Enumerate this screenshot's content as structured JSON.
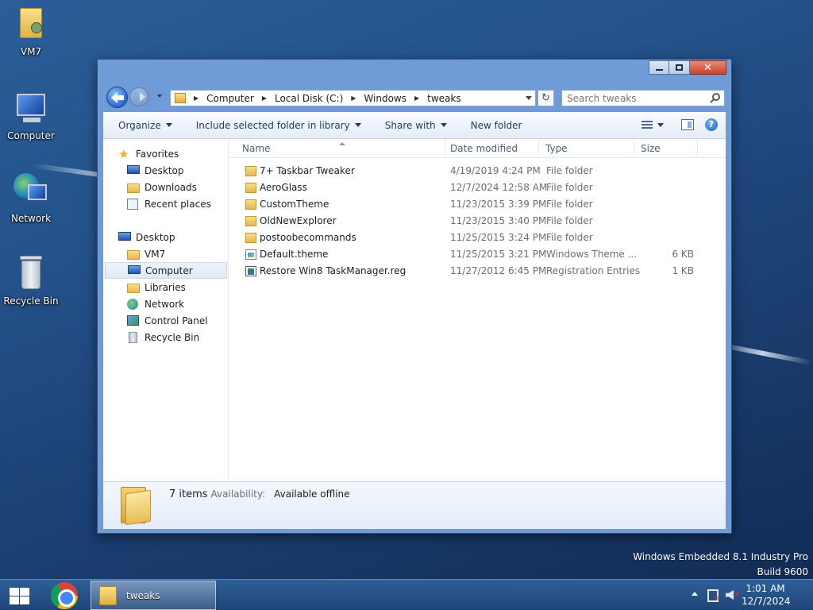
{
  "desktop": {
    "icons": [
      {
        "label": "VM7"
      },
      {
        "label": "Computer"
      },
      {
        "label": "Network"
      },
      {
        "label": "Recycle Bin"
      }
    ],
    "watermark": {
      "line1": "Windows Embedded 8.1 Industry Pro",
      "line2": "Build 9600"
    }
  },
  "window": {
    "address": {
      "crumbs": [
        "Computer",
        "Local Disk (C:)",
        "Windows",
        "tweaks"
      ]
    },
    "search": {
      "placeholder": "Search tweaks"
    },
    "toolbar": {
      "organize": "Organize",
      "include": "Include selected folder in library",
      "share": "Share with",
      "new_folder": "New folder"
    },
    "navpane": {
      "favorites": "Favorites",
      "fav_items": [
        "Desktop",
        "Downloads",
        "Recent places"
      ],
      "desktop": "Desktop",
      "desktop_items": [
        "VM7",
        "Computer",
        "Libraries",
        "Network",
        "Control Panel",
        "Recycle Bin"
      ],
      "selected": "Computer"
    },
    "columns": {
      "name": "Name",
      "date": "Date modified",
      "type": "Type",
      "size": "Size"
    },
    "files": [
      {
        "name": "7+ Taskbar Tweaker",
        "date": "4/19/2019 4:24 PM",
        "type": "File folder",
        "size": "",
        "icon": "folder-icon"
      },
      {
        "name": "AeroGlass",
        "date": "12/7/2024 12:58 AM",
        "type": "File folder",
        "size": "",
        "icon": "folder-icon"
      },
      {
        "name": "CustomTheme",
        "date": "11/23/2015 3:39 PM",
        "type": "File folder",
        "size": "",
        "icon": "folder-icon"
      },
      {
        "name": "OldNewExplorer",
        "date": "11/23/2015 3:40 PM",
        "type": "File folder",
        "size": "",
        "icon": "folder-icon"
      },
      {
        "name": "postoobecommands",
        "date": "11/25/2015 3:24 PM",
        "type": "File folder",
        "size": "",
        "icon": "folder-icon"
      },
      {
        "name": "Default.theme",
        "date": "11/25/2015 3:21 PM",
        "type": "Windows Theme ...",
        "size": "6 KB",
        "icon": "theme-file-icon"
      },
      {
        "name": "Restore Win8 TaskManager.reg",
        "date": "11/27/2012 6:45 PM",
        "type": "Registration Entries",
        "size": "1 KB",
        "icon": "reg-file-icon"
      }
    ],
    "details": {
      "count": "7 items",
      "availability_label": "Availability:",
      "availability_value": "Available offline"
    }
  },
  "taskbar": {
    "task_label": "tweaks",
    "time": "1:01 AM",
    "date": "12/7/2024"
  },
  "colors": {
    "taskbar": "#1e4577",
    "window_frame": "#6f9bd6",
    "accent": "#2c6fd5"
  }
}
